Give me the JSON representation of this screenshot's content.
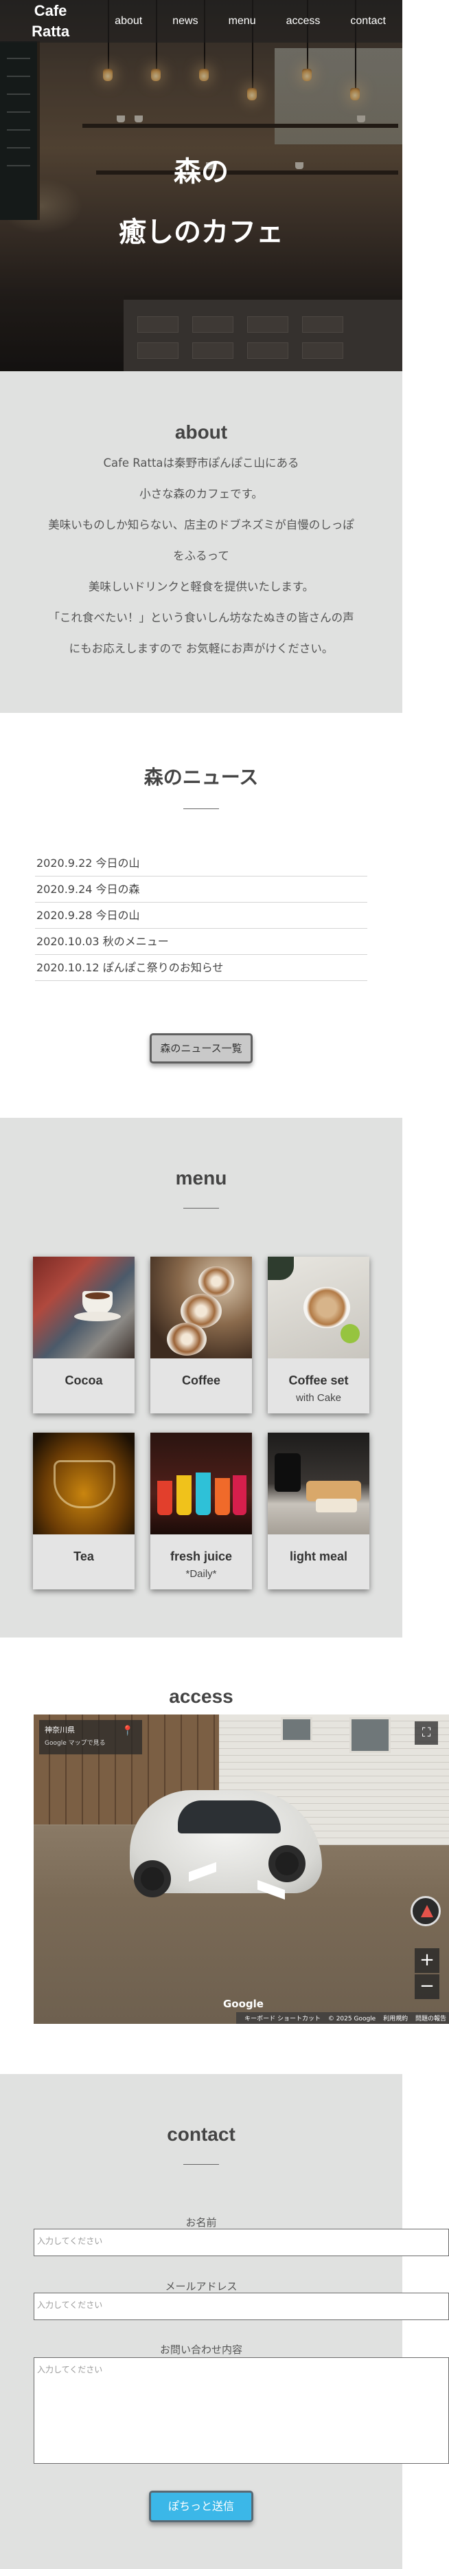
{
  "header": {
    "logo_line1": "Cafe",
    "logo_line2": "Ratta",
    "nav": [
      "about",
      "news",
      "menu",
      "access",
      "contact"
    ]
  },
  "hero": {
    "title_line1": "森の",
    "title_line2": "癒しのカフェ"
  },
  "about": {
    "title": "about",
    "lines": [
      "Cafe Rattaは秦野市ぽんぽこ山にある",
      "小さな森のカフェです。",
      "美味いものしか知らない、店主のドブネズミが自慢のしっぽ",
      "をふるって",
      "美味しいドリンクと軽食を提供いたします。",
      "「これ食べたい！」という食いしん坊なたぬきの皆さんの声",
      "にもお応えしますので お気軽にお声がけください。"
    ]
  },
  "news": {
    "title": "森のニュース",
    "items": [
      "2020.9.22 今日の山",
      "2020.9.24 今日の森",
      "2020.9.28 今日の山",
      "2020.10.03 秋のメニュー",
      "2020.10.12 ぽんぽこ祭りのお知らせ"
    ],
    "button_label": "森のニュース一覧"
  },
  "menu": {
    "title": "menu",
    "items": [
      {
        "name": "Cocoa",
        "sub": ""
      },
      {
        "name": "Coffee",
        "sub": ""
      },
      {
        "name": "Coffee set",
        "sub": "with Cake"
      },
      {
        "name": "Tea",
        "sub": ""
      },
      {
        "name": "fresh juice",
        "sub": "*Daily*"
      },
      {
        "name": "light meal",
        "sub": ""
      }
    ]
  },
  "access": {
    "title": "access",
    "map": {
      "place_name": "神奈川県",
      "open_in_maps": "Google マップで見る",
      "brand": "Google",
      "attribution": [
        "キーボード ショートカット",
        "© 2025 Google",
        "利用規約",
        "問題の報告"
      ],
      "zoom_in": "+",
      "zoom_out": "−"
    }
  },
  "contact": {
    "title": "contact",
    "name_label": "お名前",
    "name_placeholder": "入力してください",
    "email_label": "メールアドレス",
    "email_placeholder": "入力してください",
    "message_label": "お問い合わせ内容",
    "message_placeholder": "入力してください",
    "submit_label": "ぽちっと送信"
  },
  "colors": {
    "section_gray": "#e0e1e0",
    "submit_blue": "#3bb7e8",
    "text": "#444444"
  }
}
